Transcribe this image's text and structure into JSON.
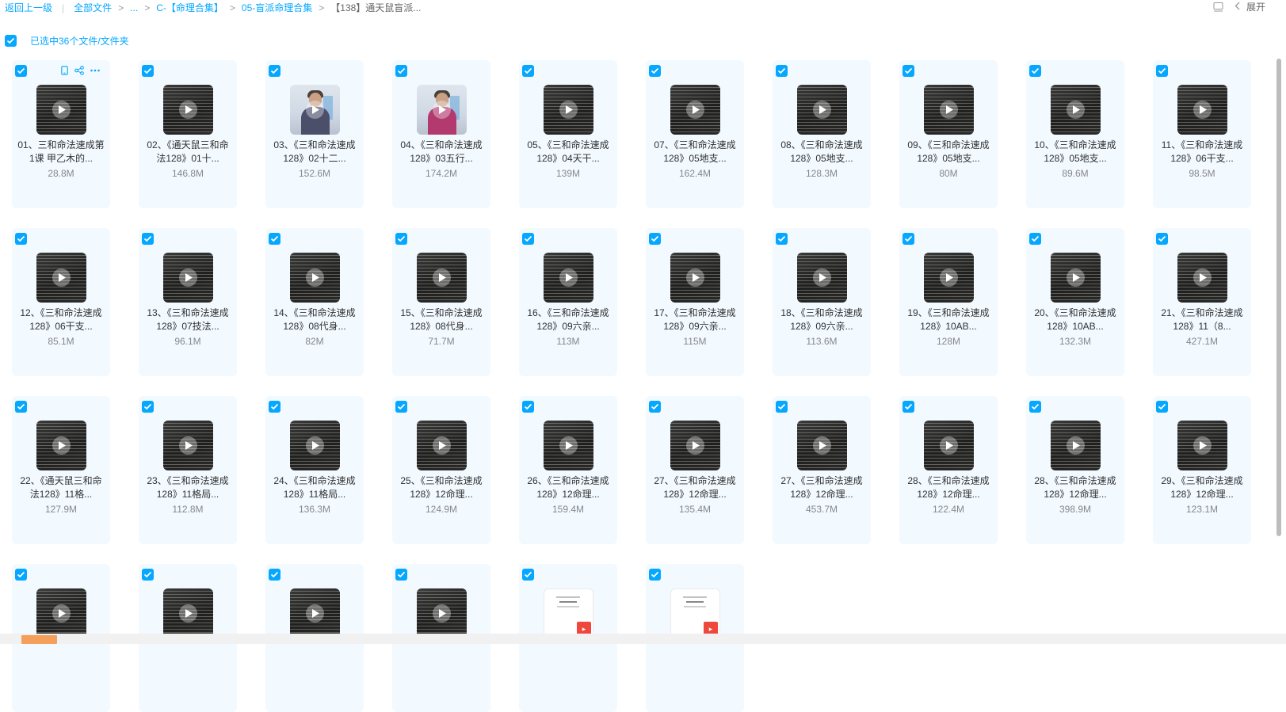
{
  "breadcrumb": {
    "back": "返回上一级",
    "divider": "|",
    "items": [
      "全部文件",
      "...",
      "C-【命理合集】",
      "05-盲派命理合集",
      "【138】通天鼠盲派..."
    ],
    "separator": ">"
  },
  "toolbar": {
    "expand_label": "展开"
  },
  "selection": {
    "text": "已选中36个文件/文件夹"
  },
  "files": [
    {
      "name": "01、三和命法速成第1课 甲乙木的...",
      "size": "28.8M",
      "thumb": "dark"
    },
    {
      "name": "02、《通天鼠三和命法128》01十...",
      "size": "146.8M",
      "thumb": "dark"
    },
    {
      "name": "03、《三和命法速成128》02十二...",
      "size": "152.6M",
      "thumb": "person"
    },
    {
      "name": "04、《三和命法速成128》03五行...",
      "size": "174.2M",
      "thumb": "person-pink"
    },
    {
      "name": "05、《三和命法速成128》04天干...",
      "size": "139M",
      "thumb": "dark"
    },
    {
      "name": "07、《三和命法速成128》05地支...",
      "size": "162.4M",
      "thumb": "dark"
    },
    {
      "name": "08、《三和命法速成128》05地支...",
      "size": "128.3M",
      "thumb": "dark"
    },
    {
      "name": "09、《三和命法速成128》05地支...",
      "size": "80M",
      "thumb": "dark"
    },
    {
      "name": "10、《三和命法速成128》05地支...",
      "size": "89.6M",
      "thumb": "dark"
    },
    {
      "name": "11、《三和命法速成128》06干支...",
      "size": "98.5M",
      "thumb": "dark"
    },
    {
      "name": "12、《三和命法速成128》06干支...",
      "size": "85.1M",
      "thumb": "dark"
    },
    {
      "name": "13、《三和命法速成128》07技法...",
      "size": "96.1M",
      "thumb": "dark"
    },
    {
      "name": "14、《三和命法速成128》08代身...",
      "size": "82M",
      "thumb": "dark"
    },
    {
      "name": "15、《三和命法速成128》08代身...",
      "size": "71.7M",
      "thumb": "dark"
    },
    {
      "name": "16、《三和命法速成128》09六亲...",
      "size": "113M",
      "thumb": "dark"
    },
    {
      "name": "17、《三和命法速成128》09六亲...",
      "size": "115M",
      "thumb": "dark"
    },
    {
      "name": "18、《三和命法速成128》09六亲...",
      "size": "113.6M",
      "thumb": "dark"
    },
    {
      "name": "19、《三和命法速成128》10AB...",
      "size": "128M",
      "thumb": "dark"
    },
    {
      "name": "20、《三和命法速成128》10AB...",
      "size": "132.3M",
      "thumb": "dark"
    },
    {
      "name": "21、《三和命法速成128》11（8...",
      "size": "427.1M",
      "thumb": "dark"
    },
    {
      "name": "22、《通天鼠三和命法128》11格...",
      "size": "127.9M",
      "thumb": "dark"
    },
    {
      "name": "23、《三和命法速成128》11格局...",
      "size": "112.8M",
      "thumb": "dark"
    },
    {
      "name": "24、《三和命法速成128》11格局...",
      "size": "136.3M",
      "thumb": "dark"
    },
    {
      "name": "25、《三和命法速成128》12命理...",
      "size": "124.9M",
      "thumb": "dark"
    },
    {
      "name": "26、《三和命法速成128》12命理...",
      "size": "159.4M",
      "thumb": "dark"
    },
    {
      "name": "27、《三和命法速成128》12命理...",
      "size": "135.4M",
      "thumb": "dark"
    },
    {
      "name": "27、《三和命法速成128》12命理...",
      "size": "453.7M",
      "thumb": "dark"
    },
    {
      "name": "28、《三和命法速成128》12命理...",
      "size": "122.4M",
      "thumb": "dark"
    },
    {
      "name": "28、《三和命法速成128》12命理...",
      "size": "398.9M",
      "thumb": "dark"
    },
    {
      "name": "29、《三和命法速成128》12命理...",
      "size": "123.1M",
      "thumb": "dark"
    },
    {
      "name": "",
      "size": "",
      "thumb": "dark"
    },
    {
      "name": "",
      "size": "",
      "thumb": "dark"
    },
    {
      "name": "",
      "size": "",
      "thumb": "dark"
    },
    {
      "name": "",
      "size": "",
      "thumb": "dark"
    },
    {
      "name": "",
      "size": "",
      "thumb": "pdf"
    },
    {
      "name": "",
      "size": "",
      "thumb": "pdf"
    }
  ],
  "colors": {
    "accent": "#06a7ff",
    "card_bg": "#f2f9ff",
    "scroll_thumb": "#f5a05a"
  },
  "icons": [
    "checkbox-checked-icon",
    "play-icon",
    "phone-icon",
    "share-icon",
    "more-icon",
    "list-view-icon",
    "chevron-left-icon",
    "pdf-icon"
  ]
}
